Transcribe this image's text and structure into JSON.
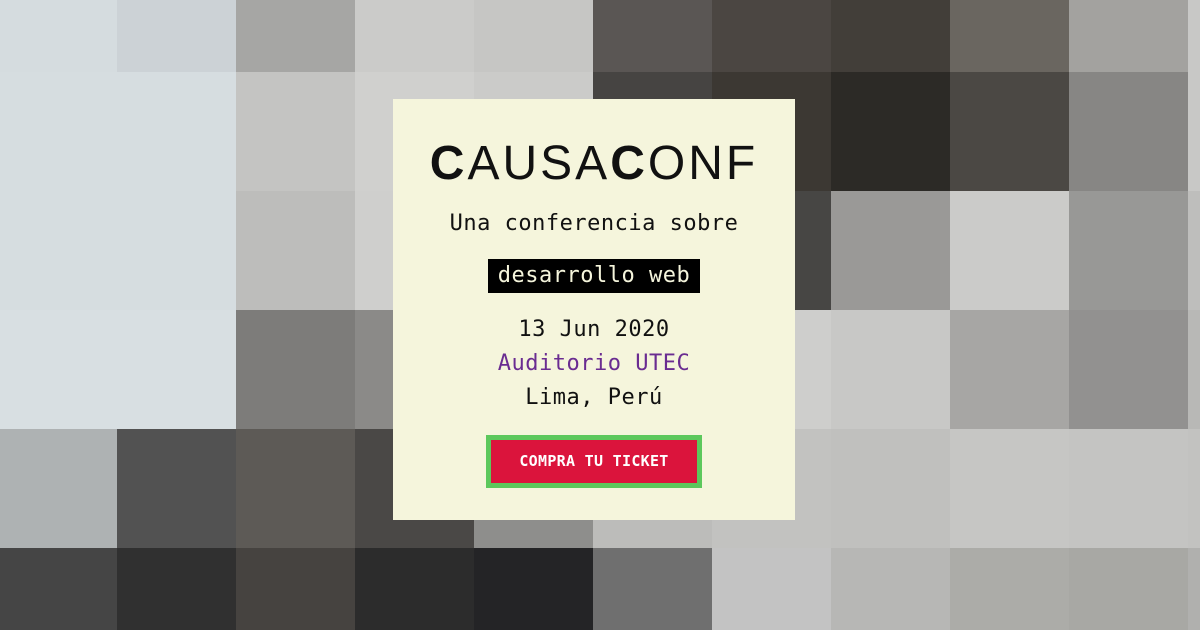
{
  "background": {
    "rows": [
      [
        "#d5dcdf",
        "#ccd2d6",
        "#a6a6a4",
        "#cbcbc9",
        "#c6c6c4",
        "#5a5654",
        "#4b4642",
        "#423e39",
        "#6a6660",
        "#a3a29f",
        "#c8c8c6"
      ],
      [
        "#d6dde0",
        "#d6dde0",
        "#c4c4c2",
        "#d0d0ce",
        "#cbcbc9",
        "#464442",
        "#3c3833",
        "#2c2a26",
        "#4b4844",
        "#878684",
        "#c8c8c6"
      ],
      [
        "#d6dde0",
        "#d6dde0",
        "#bdbdbb",
        "#cfcfcd",
        "#c4c4c2",
        "#b0b0ae",
        "#474644",
        "#9a9997",
        "#cbcbc9",
        "#989896",
        "#bebebc"
      ],
      [
        "#d8dfe2",
        "#d8dfe2",
        "#7d7c7a",
        "#8b8a88",
        "#aeaeac",
        "#c1c1bf",
        "#cececc",
        "#c8c8c6",
        "#a7a6a4",
        "#929190",
        "#b8b8b6"
      ],
      [
        "#aeb2b3",
        "#525252",
        "#5d5a56",
        "#4a4846",
        "#8e8e8c",
        "#bcbcba",
        "#c2c2c0",
        "#c0c0be",
        "#c6c6c4",
        "#c4c4c2",
        "#c2c2c0"
      ],
      [
        "#454545",
        "#303030",
        "#464340",
        "#2c2c2c",
        "#242426",
        "#6f6f6f",
        "#c3c3c3",
        "#b7b7b5",
        "#acaca8",
        "#a8a8a4",
        "#b0b0ae"
      ]
    ]
  },
  "card": {
    "logo_text": "CAUSACONF",
    "subtitle": "Una conferencia sobre",
    "highlight": "desarrollo web",
    "date": "13 Jun 2020",
    "venue": "Auditorio UTEC",
    "city": "Lima, Perú",
    "cta_label": "COMPRA TU TICKET"
  },
  "colors": {
    "card_bg": "#f5f5dc",
    "venue": "#6a2c91",
    "cta_bg": "#db143c",
    "cta_border": "#5cc85c"
  }
}
